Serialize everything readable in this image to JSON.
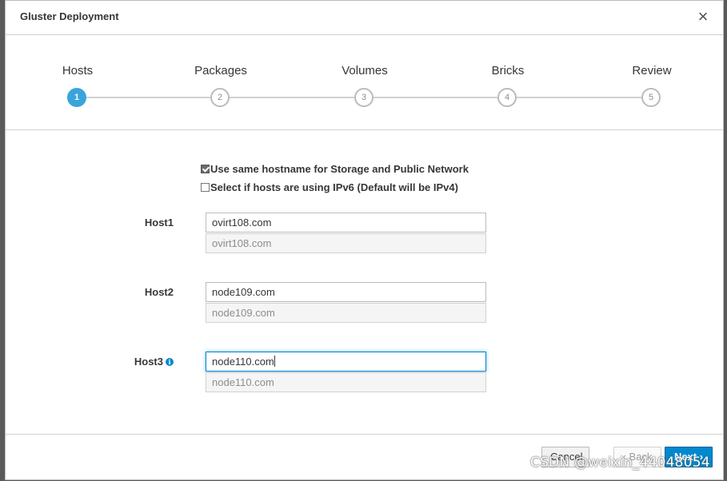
{
  "dialog": {
    "title": "Gluster Deployment",
    "close_symbol": "×"
  },
  "steps": [
    {
      "label": "Hosts",
      "number": "1",
      "active": true
    },
    {
      "label": "Packages",
      "number": "2",
      "active": false
    },
    {
      "label": "Volumes",
      "number": "3",
      "active": false
    },
    {
      "label": "Bricks",
      "number": "4",
      "active": false
    },
    {
      "label": "Review",
      "number": "5",
      "active": false
    }
  ],
  "options": {
    "same_hostname": {
      "label": "Use same hostname for Storage and Public Network",
      "checked": true
    },
    "ipv6": {
      "label": "Select if hosts are using IPv6 (Default will be IPv4)",
      "checked": false
    }
  },
  "hosts": [
    {
      "label": "Host1",
      "value": "ovirt108.com",
      "public_value": "ovirt108.com"
    },
    {
      "label": "Host2",
      "value": "node109.com",
      "public_value": "node109.com"
    },
    {
      "label": "Host3",
      "value": "node110.com",
      "public_value": "node110.com",
      "info_icon": "i"
    }
  ],
  "footer": {
    "cancel_label": "Cancel",
    "back_label": "‹ Back",
    "next_label": "Next ›"
  },
  "watermark": "CSDN @weixin_44048054",
  "colors": {
    "accent": "#39a5dc",
    "primary_button": "#0088ce"
  }
}
